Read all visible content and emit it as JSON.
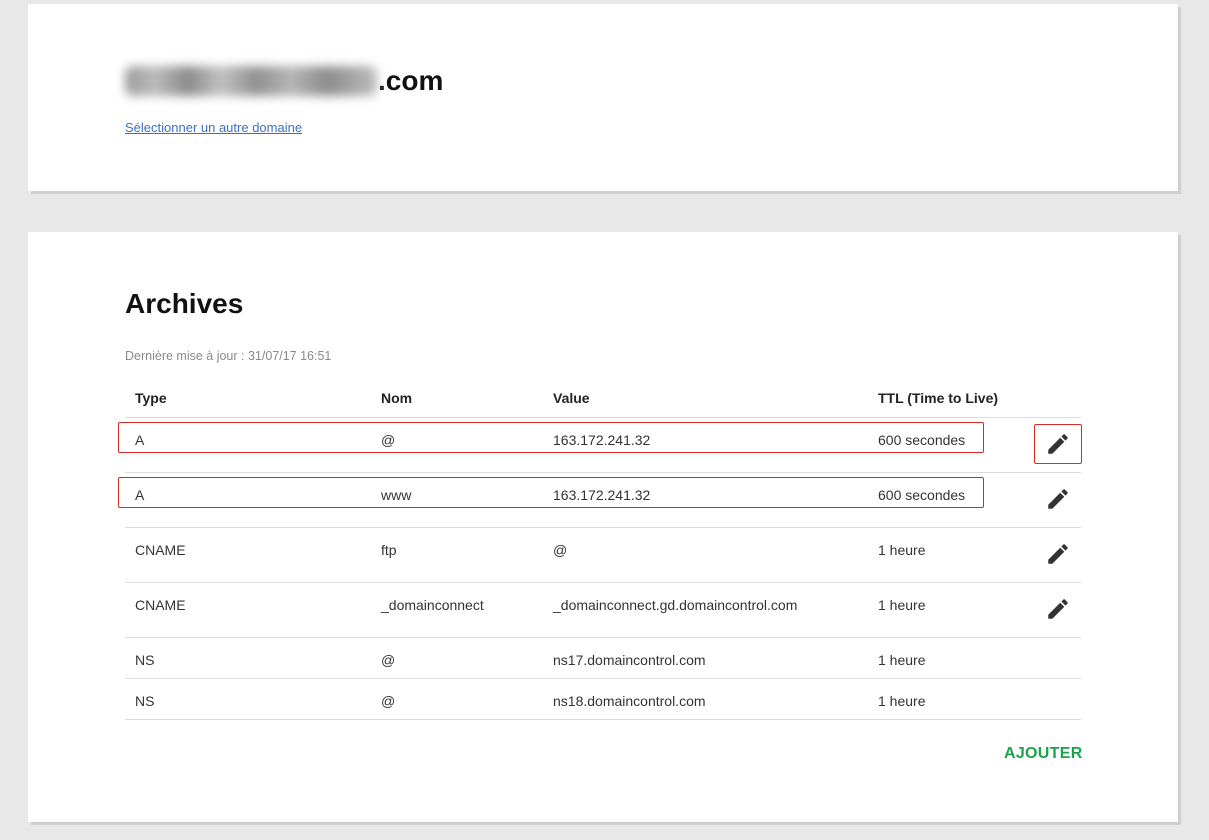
{
  "domain": {
    "name_suffix": ".com",
    "select_other_link": "Sélectionner un autre domaine"
  },
  "records": {
    "title": "Archives",
    "last_update": "Dernière mise à jour : 31/07/17 16:51",
    "columns": {
      "type": "Type",
      "name": "Nom",
      "value": "Value",
      "ttl": "TTL (Time to Live)"
    },
    "rows": [
      {
        "type": "A",
        "name": "@",
        "value": "163.172.241.32",
        "ttl": "600 secondes"
      },
      {
        "type": "A",
        "name": "www",
        "value": "163.172.241.32",
        "ttl": "600 secondes"
      },
      {
        "type": "CNAME",
        "name": "ftp",
        "value": "@",
        "ttl": "1 heure"
      },
      {
        "type": "CNAME",
        "name": "_domainconnect",
        "value": "_domainconnect.gd.domaincontrol.com",
        "ttl": "1 heure"
      },
      {
        "type": "NS",
        "name": "@",
        "value": "ns17.domaincontrol.com",
        "ttl": "1 heure"
      },
      {
        "type": "NS",
        "name": "@",
        "value": "ns18.domaincontrol.com",
        "ttl": "1 heure"
      }
    ],
    "add_label": "AJOUTER"
  },
  "colors": {
    "highlight": "#d92a2a",
    "add_button": "#1aa34a",
    "link": "#3a6ec7"
  },
  "icons": {
    "edit": "pencil-icon"
  }
}
